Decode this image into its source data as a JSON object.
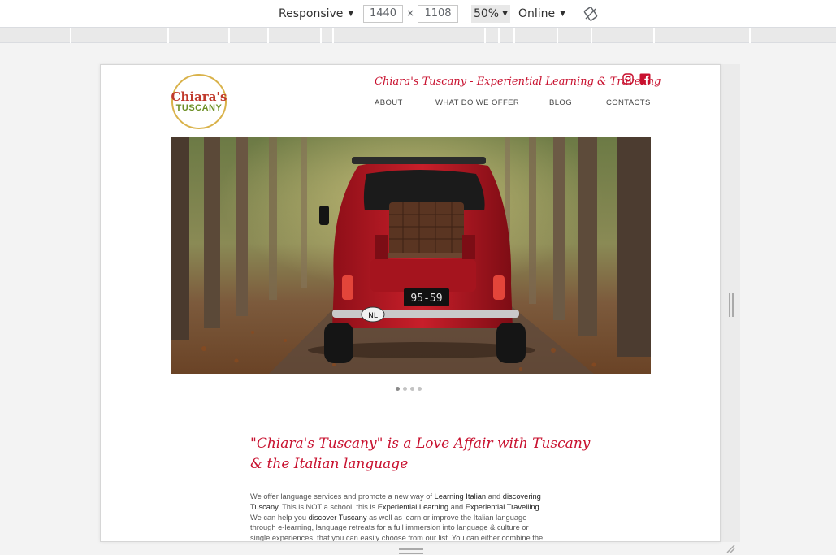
{
  "devtools": {
    "device": "Responsive",
    "width": "1440",
    "height": "1108",
    "zoom": "50%",
    "throttle": "Online"
  },
  "site": {
    "logo": {
      "top": "Chiara's",
      "bottom": "TUSCANY"
    },
    "tagline": "Chiara's Tuscany - Experiential Learning & Traveling",
    "social": [
      {
        "icon": "instagram-icon"
      },
      {
        "icon": "facebook-icon"
      }
    ],
    "nav": [
      {
        "label": "ABOUT"
      },
      {
        "label": "WHAT DO WE OFFER"
      },
      {
        "label": "BLOG"
      },
      {
        "label": "CONTACTS"
      }
    ],
    "carousel": {
      "slides": 4,
      "active": 1
    },
    "intro": {
      "title_line1": "\"Chiara's Tuscany\" is a Love Affair with Tuscany",
      "title_line2": "& the Italian language",
      "body_lines": [
        [
          "We offer language services and promote a new way of ",
          "Learning Italian",
          " and ",
          "discovering"
        ],
        [
          "Tuscany",
          ". This is NOT a school, this is ",
          "Experiential Learning",
          " and ",
          "Experiential Travelling",
          "."
        ],
        [
          "We can help you ",
          "discover Tuscany",
          " as well as learn or improve the Italian language"
        ],
        [
          "through e-learning, language retreats for a full immersion into language & culture or"
        ],
        [
          "single experiences, that you can easily choose from our list. You can either combine the"
        ]
      ]
    }
  },
  "colors": {
    "accent_red": "#c8102e",
    "logo_gold": "#d9b24a",
    "logo_green": "#6b8e23"
  }
}
